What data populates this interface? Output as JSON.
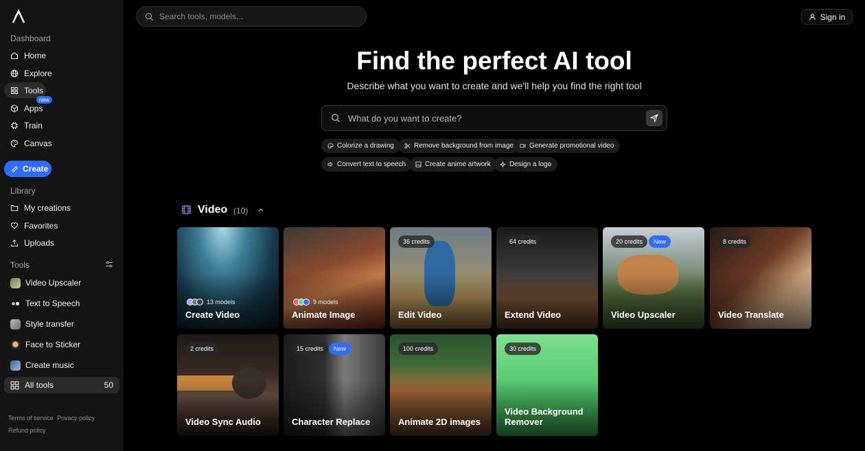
{
  "sidebar": {
    "dashboard_title": "Dashboard",
    "nav": [
      {
        "label": "Home"
      },
      {
        "label": "Explore"
      },
      {
        "label": "Tools"
      },
      {
        "label": "Apps",
        "badge": "new"
      },
      {
        "label": "Train"
      },
      {
        "label": "Canvas"
      }
    ],
    "create_label": "Create",
    "library_title": "Library",
    "library": [
      {
        "label": "My creations"
      },
      {
        "label": "Favorites"
      },
      {
        "label": "Uploads"
      }
    ],
    "tools_title": "Tools",
    "tools": [
      {
        "label": "Video Upscaler"
      },
      {
        "label": "Text to Speech"
      },
      {
        "label": "Style transfer"
      },
      {
        "label": "Face to Sticker"
      },
      {
        "label": "Create music"
      }
    ],
    "all_tools_label": "All tools",
    "all_tools_count": "50",
    "footer": {
      "terms": "Terms of service",
      "privacy": "Privacy policy",
      "refund": "Refund policy"
    }
  },
  "topbar": {
    "search_placeholder": "Search tools, models...",
    "signin_label": "Sign in"
  },
  "hero": {
    "title": "Find the perfect AI tool",
    "subtitle": "Describe what you want to create and we'll help you find the right tool",
    "prompt_placeholder": "What do you want to create?",
    "chips": [
      {
        "label": "Colorize a drawing"
      },
      {
        "label": "Remove background from image"
      },
      {
        "label": "Generate promotional video"
      },
      {
        "label": "Convert text to speech"
      },
      {
        "label": "Create anime artwork"
      },
      {
        "label": "Design a logo"
      }
    ]
  },
  "section": {
    "title": "Video",
    "count": "(10)"
  },
  "cards": [
    {
      "title": "Create Video",
      "models": "13 models"
    },
    {
      "title": "Animate Image",
      "models": "9 models"
    },
    {
      "title": "Edit Video",
      "credits": "36 credits"
    },
    {
      "title": "Extend Video",
      "credits": "64 credits"
    },
    {
      "title": "Video Upscaler",
      "credits": "20 credits",
      "badge": "New"
    },
    {
      "title": "Video Translate",
      "credits": "8 credits"
    },
    {
      "title": "Video Sync Audio",
      "credits": "2 credits"
    },
    {
      "title": "Character Replace",
      "credits": "15 credits",
      "badge": "New"
    },
    {
      "title": "Animate 2D images",
      "credits": "100 credits"
    },
    {
      "title": "Video Background Remover",
      "credits": "30 credits"
    }
  ],
  "colors": {
    "accent": "#2f6bff",
    "sidebar_bg": "#141414",
    "page_bg": "#000000"
  }
}
